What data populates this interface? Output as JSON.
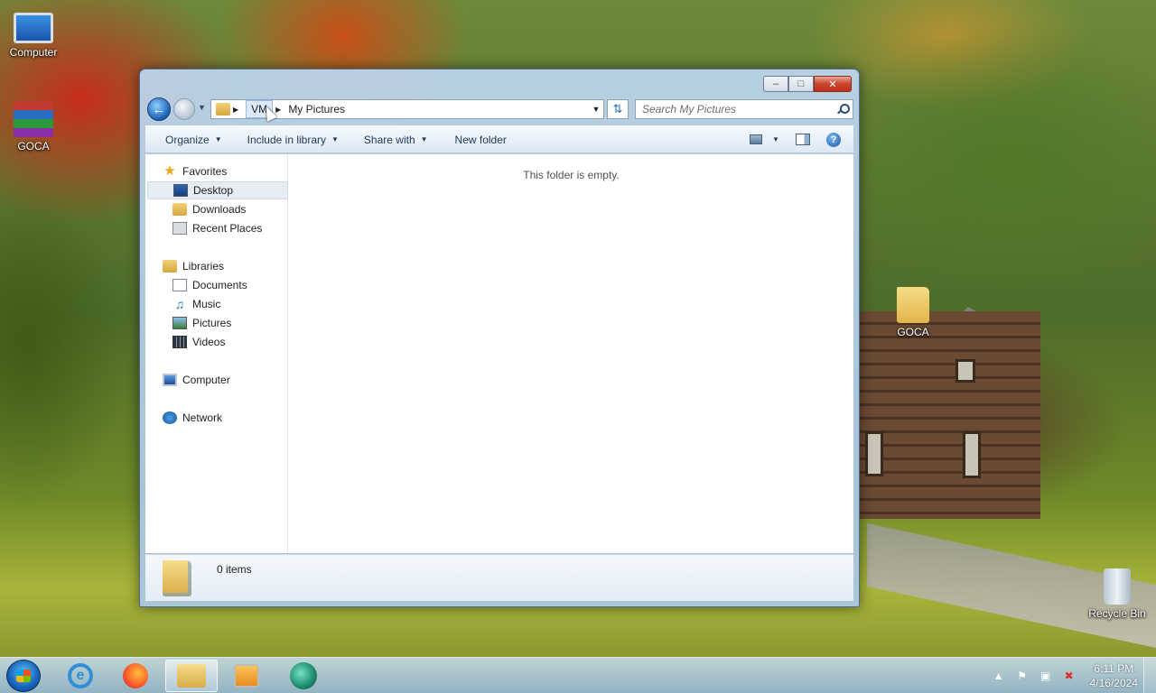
{
  "desktop": {
    "icons": [
      {
        "label": "Computer"
      },
      {
        "label": "GOCA"
      },
      {
        "label": "GOCA"
      },
      {
        "label": "Recycle Bin"
      }
    ]
  },
  "window": {
    "breadcrumb": [
      "VM",
      "My Pictures"
    ],
    "search_placeholder": "Search My Pictures",
    "toolbar": {
      "organize": "Organize",
      "include_in_library": "Include in library",
      "share_with": "Share with",
      "new_folder": "New folder"
    },
    "nav": {
      "favorites": "Favorites",
      "desktop": "Desktop",
      "downloads": "Downloads",
      "recent_places": "Recent Places",
      "libraries": "Libraries",
      "documents": "Documents",
      "music": "Music",
      "pictures": "Pictures",
      "videos": "Videos",
      "computer": "Computer",
      "network": "Network"
    },
    "empty_message": "This folder is empty.",
    "details": {
      "item_count": "0 items"
    }
  },
  "taskbar": {
    "clock_time": "6:11 PM",
    "clock_date": "4/16/2024"
  }
}
